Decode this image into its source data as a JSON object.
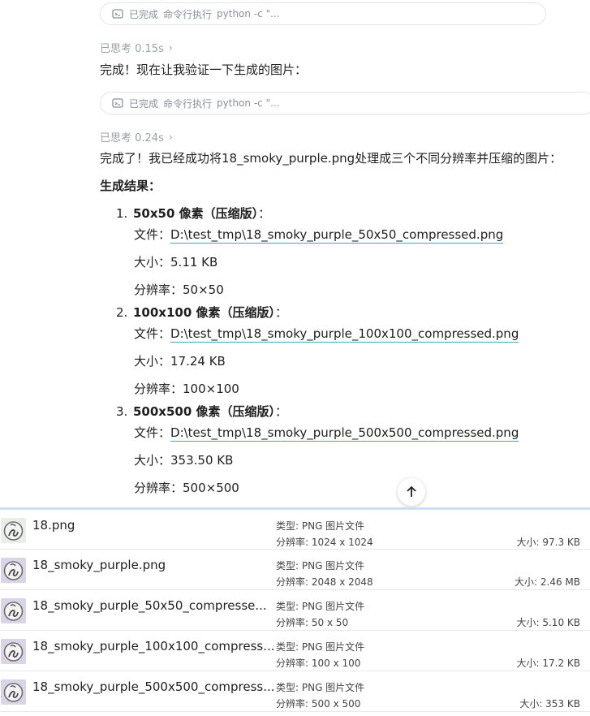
{
  "chat": {
    "cmd1": {
      "status": "已完成",
      "label": "命令行执行",
      "code": "python -c \"..."
    },
    "thought1": "已思考 0.15s",
    "para1": "完成！现在让我验证一下生成的图片：",
    "cmd2": {
      "status": "已完成",
      "label": "命令行执行",
      "code": "python -c \"..."
    },
    "thought2": "已思考 0.24s",
    "para2": "完成了！我已经成功将18_smoky_purple.png处理成三个不同分辨率并压缩的图片：",
    "results_title": "生成结果：",
    "items": [
      {
        "num": "1.",
        "title": "50x50 像素（压缩版）",
        "colon": "：",
        "file_label": "文件：",
        "file": "D:\\test_tmp\\18_smoky_purple_50x50_compressed.png",
        "size_label": "大小：",
        "size": "5.11 KB",
        "res_label": "分辨率：",
        "res": "50×50"
      },
      {
        "num": "2.",
        "title": "100x100 像素（压缩版）",
        "colon": "：",
        "file_label": "文件：",
        "file": "D:\\test_tmp\\18_smoky_purple_100x100_compressed.png",
        "size_label": "大小：",
        "size": "17.24 KB",
        "res_label": "分辨率：",
        "res": "100×100"
      },
      {
        "num": "3.",
        "title": "500x500 像素（压缩版）",
        "colon": "：",
        "file_label": "文件：",
        "file": "D:\\test_tmp\\18_smoky_purple_500x500_compressed.png",
        "size_label": "大小：",
        "size": "353.50 KB",
        "res_label": "分辨率：",
        "res": "500×500"
      }
    ]
  },
  "explorer": {
    "files": [
      {
        "name": "18.png",
        "type": "类型: PNG 图片文件",
        "res": "分辨率: 1024 x 1024",
        "size": "大小: 97.3 KB",
        "thumb_bg": "#e9efe8"
      },
      {
        "name": "18_smoky_purple.png",
        "type": "类型: PNG 图片文件",
        "res": "分辨率: 2048 x 2048",
        "size": "大小: 2.46 MB",
        "thumb_bg": "#d9d4e6"
      },
      {
        "name": "18_smoky_purple_50x50_compresse...",
        "type": "类型: PNG 图片文件",
        "res": "分辨率: 50 x 50",
        "size": "大小: 5.10 KB",
        "thumb_bg": "#d9d4e6"
      },
      {
        "name": "18_smoky_purple_100x100_compress...",
        "type": "类型: PNG 图片文件",
        "res": "分辨率: 100 x 100",
        "size": "大小: 17.2 KB",
        "thumb_bg": "#d9d4e6"
      },
      {
        "name": "18_smoky_purple_500x500_compress...",
        "type": "类型: PNG 图片文件",
        "res": "分辨率: 500 x 500",
        "size": "大小: 353 KB",
        "thumb_bg": "#d9d4e6"
      }
    ]
  },
  "colors": {
    "link_underline": "#4aa3c9",
    "explorer_border": "#c9dff2"
  }
}
